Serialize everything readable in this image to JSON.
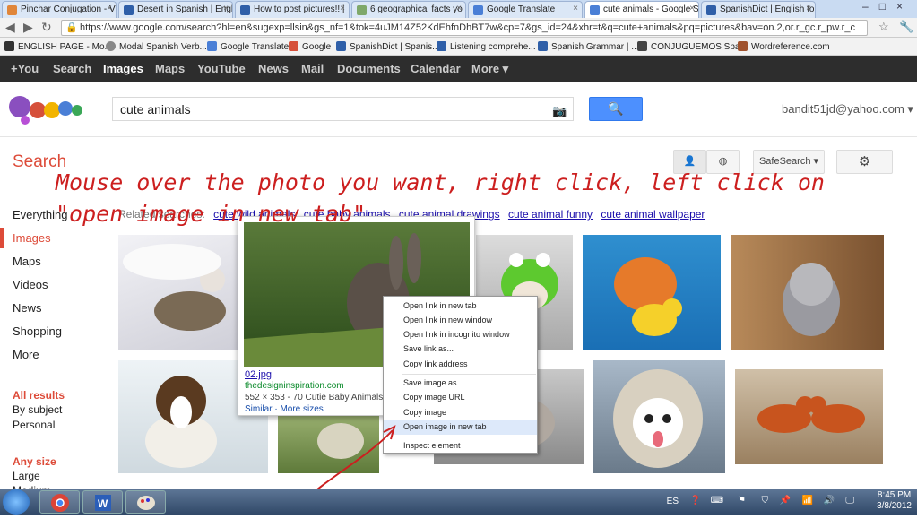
{
  "tabs": [
    {
      "title": "Pinchar Conjugation - V",
      "color": "#e0863a"
    },
    {
      "title": "Desert in Spanish | Engl",
      "color": "#2f5fa8"
    },
    {
      "title": "How to post pictures!! |",
      "color": "#2f5fa8"
    },
    {
      "title": "6 geographical facts yo",
      "color": "#7fa86a"
    },
    {
      "title": "Google Translate",
      "color": "#4a7fd6"
    },
    {
      "title": "cute animals - Google S",
      "color": "#4a7fd6"
    },
    {
      "title": "SpanishDict | English to",
      "color": "#2f5fa8"
    }
  ],
  "address": {
    "url": "https://www.google.com/search?hl=en&sugexp=llsin&gs_nf=1&tok=4uJM14Z52KdEhfnDhBT7w&cp=7&gs_id=24&xhr=t&q=cute+animals&pq=pictures&bav=on.2,or.r_gc.r_pw.r_c"
  },
  "bookmarks": [
    {
      "label": "ENGLISH PAGE - Mo...",
      "color": "#333"
    },
    {
      "label": "Modal Spanish Verb...",
      "color": "#888"
    },
    {
      "label": "Google Translate",
      "color": "#4a7fd6"
    },
    {
      "label": "Google",
      "color": "#d6503a"
    },
    {
      "label": "SpanishDict | Spanis...",
      "color": "#2f5fa8"
    },
    {
      "label": "Listening comprehe...",
      "color": "#2f5fa8"
    },
    {
      "label": "Spanish Grammar | ...",
      "color": "#2f5fa8"
    },
    {
      "label": "CONJUGUEMOS Spa...",
      "color": "#444"
    },
    {
      "label": "Wordreference.com",
      "color": "#a0522d"
    }
  ],
  "gbar": [
    "+You",
    "Search",
    "Images",
    "Maps",
    "YouTube",
    "News",
    "Mail",
    "Documents",
    "Calendar",
    "More ▾"
  ],
  "search": {
    "query": "cute animals",
    "button": "🔍"
  },
  "account": "bandit51jd@yahoo.com ▾",
  "search_label": "Search",
  "toolbar": {
    "safesearch": "SafeSearch ▾"
  },
  "instruction": "Mouse over the photo you want, right click, left click on \"open image in new tab\"",
  "related": {
    "prefix": "Related searches:",
    "links": [
      "cute wild animals",
      "cute baby animals",
      "cute animal drawings",
      "cute animal funny",
      "cute animal wallpaper"
    ]
  },
  "leftnav": {
    "items": [
      "Everything",
      "Images",
      "Maps",
      "Videos",
      "News",
      "Shopping",
      "More"
    ],
    "results": "All results",
    "by_subject": "By subject",
    "personal": "Personal",
    "size_title": "Any size",
    "large": "Large",
    "medium": "Medium"
  },
  "hovercard": {
    "filename": "02.jpg",
    "site": "thedesigninspiration.com",
    "meta": "552 × 353 - 70 Cutie Baby Animals Bri",
    "links": "Similar · More sizes"
  },
  "context_menu": [
    "Open link in new tab",
    "Open link in new window",
    "Open link in incognito window",
    "Save link as...",
    "Copy link address",
    "Save image as...",
    "Copy image URL",
    "Copy image",
    "Open image in new tab",
    "Inspect element"
  ],
  "taskbar": {
    "lang": "ES",
    "time": "8:45 PM",
    "date": "3/8/2012"
  }
}
